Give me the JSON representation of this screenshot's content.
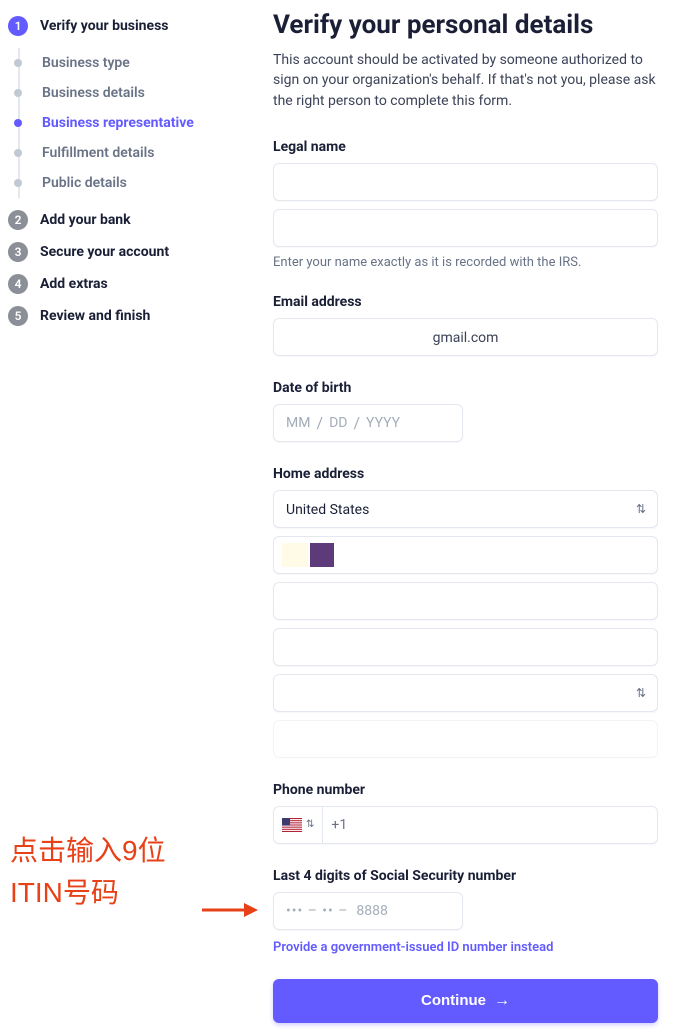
{
  "sidebar": {
    "steps": [
      {
        "num": "1",
        "label": "Verify your business",
        "active": true,
        "substeps": [
          {
            "label": "Business type",
            "active": false
          },
          {
            "label": "Business details",
            "active": false
          },
          {
            "label": "Business representative",
            "active": true
          },
          {
            "label": "Fulfillment details",
            "active": false
          },
          {
            "label": "Public details",
            "active": false
          }
        ]
      },
      {
        "num": "2",
        "label": "Add your bank"
      },
      {
        "num": "3",
        "label": "Secure your account"
      },
      {
        "num": "4",
        "label": "Add extras"
      },
      {
        "num": "5",
        "label": "Review and finish"
      }
    ]
  },
  "main": {
    "title": "Verify your personal details",
    "intro": "This account should be activated by someone authorized to sign on your organization's behalf. If that's not you, please ask the right person to complete this form."
  },
  "legal_name": {
    "label": "Legal name",
    "helper": "Enter your name exactly as it is recorded with the IRS."
  },
  "email": {
    "label": "Email address",
    "value": "gmail.com"
  },
  "dob": {
    "label": "Date of birth",
    "mm": "MM",
    "dd": "DD",
    "yyyy": "YYYY",
    "sep": "/"
  },
  "address": {
    "label": "Home address",
    "country": "United States"
  },
  "phone": {
    "label": "Phone number",
    "prefix": "+1"
  },
  "ssn": {
    "label": "Last 4 digits of Social Security number",
    "mask": "••• – •• –",
    "placeholder": "8888",
    "link": "Provide a government-issued ID number instead"
  },
  "continue": "Continue",
  "annotation": {
    "line1": "点击输入9位",
    "line2": "ITIN号码"
  }
}
